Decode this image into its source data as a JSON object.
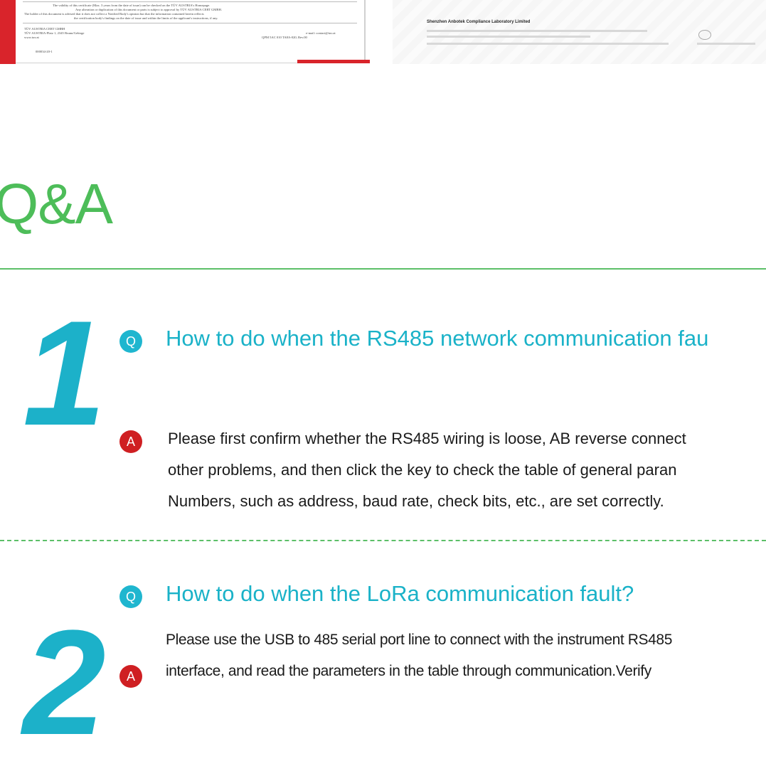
{
  "certificates": {
    "left": {
      "validity_text": "The validity of this certificate (Max. 3 years from the date of issue) can be checked on the TÜV AUSTRIA's Homepage.",
      "alteration_text": "Any alteration or duplication of this document or parts is subject to approval by TÜV AUSTRIA CERT GMBH.",
      "holder_text": "The holder of this document is advised that it does not collect a Notified Body's opinion but that the information contained herein reflects",
      "findings_text": "the certification body's findings on the date of issue and within the limits of the applicant's instructions, if any.",
      "company": "TÜV AUSTRIA CERT GMBH",
      "address": "TÜV AUSTRIA-Platz 1, 2345 Brunn/Gebirge",
      "website": "www.tuv.at",
      "email": "e-mail: contact@tuv.at",
      "qpm": "QPM 5AC 010 TA8A-020, Rev.00",
      "cert_number": "000034-20-1"
    },
    "right": {
      "lab_name": "Shenzhen Anbotek Compliance Laboratory Limited"
    }
  },
  "section_title": "Q&A",
  "qa_items": [
    {
      "number": "1",
      "q_badge": "Q",
      "question": "How to do when the RS485 network communication fau",
      "a_badge": "A",
      "answer_lines": [
        "Please first confirm whether the RS485 wiring is loose, AB reverse connect",
        "other problems, and then click the key to check the table of general paran",
        "Numbers, such as address, baud rate, check bits, etc., are set correctly."
      ]
    },
    {
      "number": "2",
      "q_badge": "Q",
      "question": "How to do when the LoRa communication fault?",
      "a_badge": "A",
      "answer_lines": [
        "Please use the USB to 485 serial port line to connect with the instrument RS485",
        "interface, and read the parameters in the table through communication.Verify"
      ]
    }
  ],
  "colors": {
    "green": "#4dbd59",
    "teal": "#1cb1c9",
    "red": "#cf1f22"
  }
}
